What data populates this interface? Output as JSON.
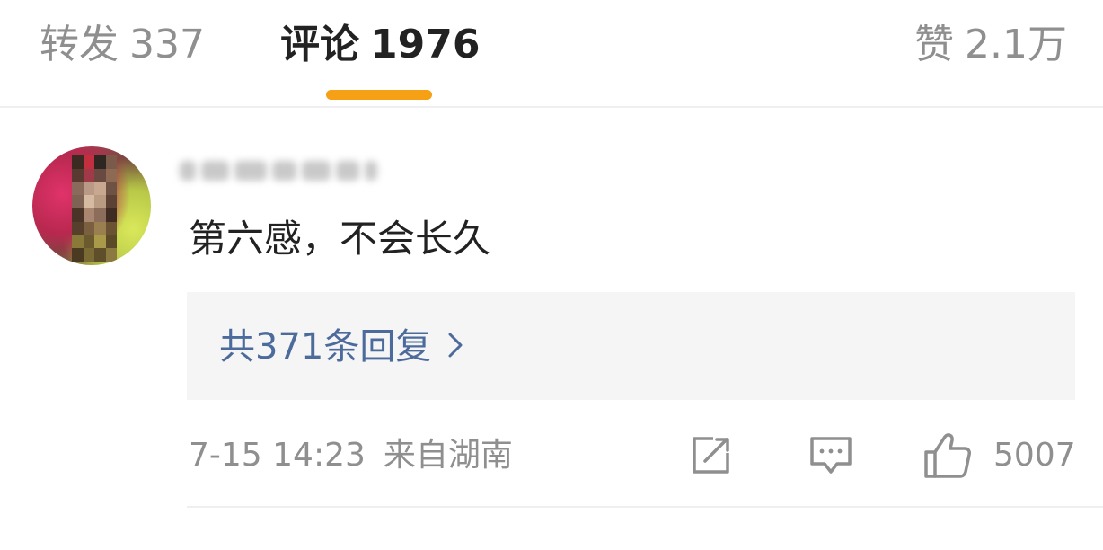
{
  "tabs": {
    "repost": {
      "label": "转发",
      "count": "337"
    },
    "comments": {
      "label": "评论",
      "count": "1976"
    },
    "likes": {
      "label": "赞",
      "count": "2.1万"
    }
  },
  "accent_color": "#f6a015",
  "link_color": "#4c6b9c",
  "comment": {
    "text": "第六感，不会长久",
    "replies_link": "共371条回复",
    "time": "7-15 14:23",
    "location": "来自湖南",
    "like_count": "5007",
    "icons": [
      "share-icon",
      "reply-icon",
      "like-icon",
      "chevron-right-icon"
    ]
  }
}
